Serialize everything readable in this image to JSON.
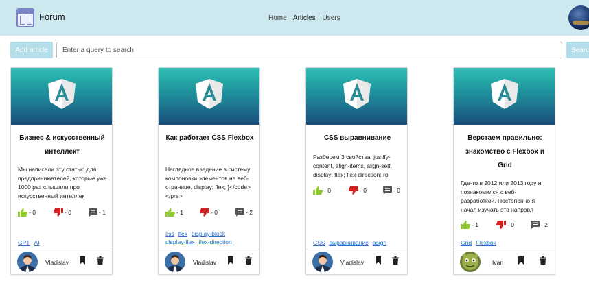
{
  "app": {
    "brand": "Forum"
  },
  "nav": {
    "items": [
      "Home",
      "Articles",
      "Users"
    ],
    "active": "Articles"
  },
  "toolbar": {
    "add_label": "Add article",
    "search_placeholder": "Enter a query to search",
    "search_label": "Search"
  },
  "colors": {
    "header_bg": "#cde9ef",
    "button_bg": "#b4dfea",
    "like": "#8ccb2b",
    "dislike": "#d62020",
    "tag_link": "#2a6ec9"
  },
  "cards": [
    {
      "title": "Бизнес & искусственный интеллект",
      "text": "Мы написали эту статью для предпринимателей, которые уже 1000 раз слышали про искусственный интеллек",
      "likes": "- 0",
      "dislikes": "- 0",
      "comments": "- 1",
      "tags": [
        "GPT",
        "AI"
      ],
      "author": "Vladislav"
    },
    {
      "title": "Как работает CSS Flexbox",
      "text": "Наглядное введение в систему компоновки элементов на веб-странице. display: flex; }</code></pre>",
      "likes": "- 1",
      "dislikes": "- 0",
      "comments": "- 2",
      "tags": [
        "css",
        "flex",
        "display-block",
        "display-flex",
        "flex-direction"
      ],
      "author": "Vladislav"
    },
    {
      "title": "CSS выравнивание",
      "text": "Разберем 3 свойства: justify-content, align-items, align-self. display: flex; flex-direction: ro",
      "likes": "- 0",
      "dislikes": "- 0",
      "comments": "- 0",
      "tags": [
        "CSS",
        "выравнивание",
        "asign"
      ],
      "author": "Vladislav"
    },
    {
      "title": "Верстаем правильно: знакомство с Flexbox и Grid",
      "text": "Где-то в 2012 или 2013 году я познакомился с веб-разработкой. Постепенно я начал изучать это направл",
      "likes": "- 1",
      "dislikes": "- 0",
      "comments": "- 2",
      "tags": [
        "Grid",
        "Flexbox"
      ],
      "author": "Ivan"
    }
  ]
}
